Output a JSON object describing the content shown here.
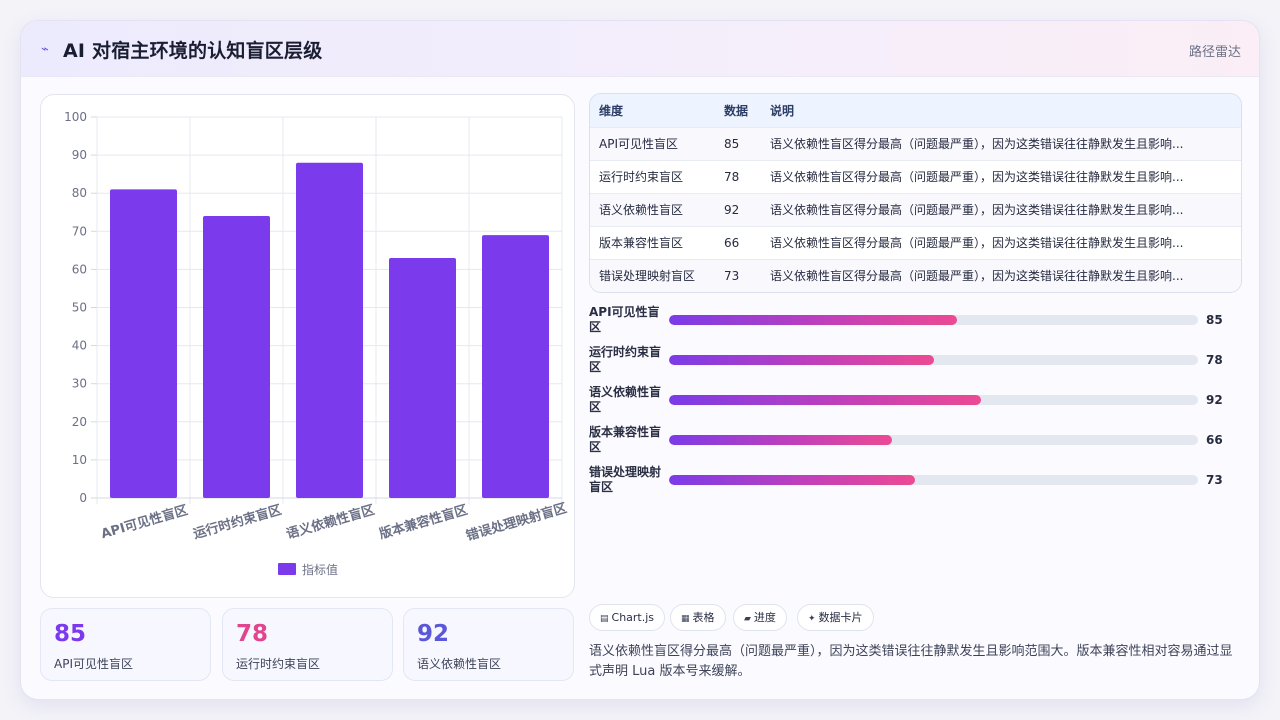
{
  "header": {
    "icon": "⌁",
    "title": "AI 对宿主环境的认知盲区层级",
    "right_label": "路径雷达"
  },
  "chart_data": {
    "type": "bar",
    "categories": [
      "API可见性盲区",
      "运行时约束盲区",
      "语义依赖性盲区",
      "版本兼容性盲区",
      "错误处理映射盲区"
    ],
    "series": [
      {
        "name": "指标值",
        "values": [
          81,
          74,
          88,
          63,
          69
        ],
        "color": "#7c3aed"
      }
    ],
    "ylim": [
      0,
      100
    ],
    "yticks": [
      0,
      10,
      20,
      30,
      40,
      50,
      60,
      70,
      80,
      90,
      100
    ],
    "grid": true,
    "legend": "bottom"
  },
  "kpis": [
    {
      "value": "85",
      "label": "API可见性盲区",
      "color": "#7c3aed"
    },
    {
      "value": "78",
      "label": "运行时约束盲区",
      "color": "#e0458e"
    },
    {
      "value": "92",
      "label": "语义依赖性盲区",
      "color": "#5b57d9"
    }
  ],
  "table": {
    "headers": [
      "维度",
      "数据",
      "说明"
    ],
    "rows": [
      [
        "API可见性盲区",
        "85",
        "语义依赖性盲区得分最高（问题最严重），因为这类错误往往静默发生且影响..."
      ],
      [
        "运行时约束盲区",
        "78",
        "语义依赖性盲区得分最高（问题最严重），因为这类错误往往静默发生且影响..."
      ],
      [
        "语义依赖性盲区",
        "92",
        "语义依赖性盲区得分最高（问题最严重），因为这类错误往往静默发生且影响..."
      ],
      [
        "版本兼容性盲区",
        "66",
        "语义依赖性盲区得分最高（问题最严重），因为这类错误往往静默发生且影响..."
      ],
      [
        "错误处理映射盲区",
        "73",
        "语义依赖性盲区得分最高（问题最严重），因为这类错误往往静默发生且影响..."
      ]
    ]
  },
  "progress": [
    {
      "label": "API可见性盲区",
      "value": "85",
      "fill": 0.545
    },
    {
      "label": "运行时约束盲区",
      "value": "78",
      "fill": 0.5
    },
    {
      "label": "语义依赖性盲区",
      "value": "92",
      "fill": 0.59
    },
    {
      "label": "版本兼容性盲区",
      "value": "66",
      "fill": 0.422
    },
    {
      "label": "错误处理映射盲区",
      "value": "73",
      "fill": 0.465
    }
  ],
  "chips": [
    {
      "icon": "▤",
      "label": "Chart.js"
    },
    {
      "icon": "▦",
      "label": "表格"
    },
    {
      "icon": "▰",
      "label": "进度"
    },
    {
      "icon": "✦",
      "label": "数据卡片"
    }
  ],
  "note": "语义依赖性盲区得分最高（问题最严重），因为这类错误往往静默发生且影响范围大。版本兼容性相对容易通过显式声明 Lua 版本号来缓解。"
}
